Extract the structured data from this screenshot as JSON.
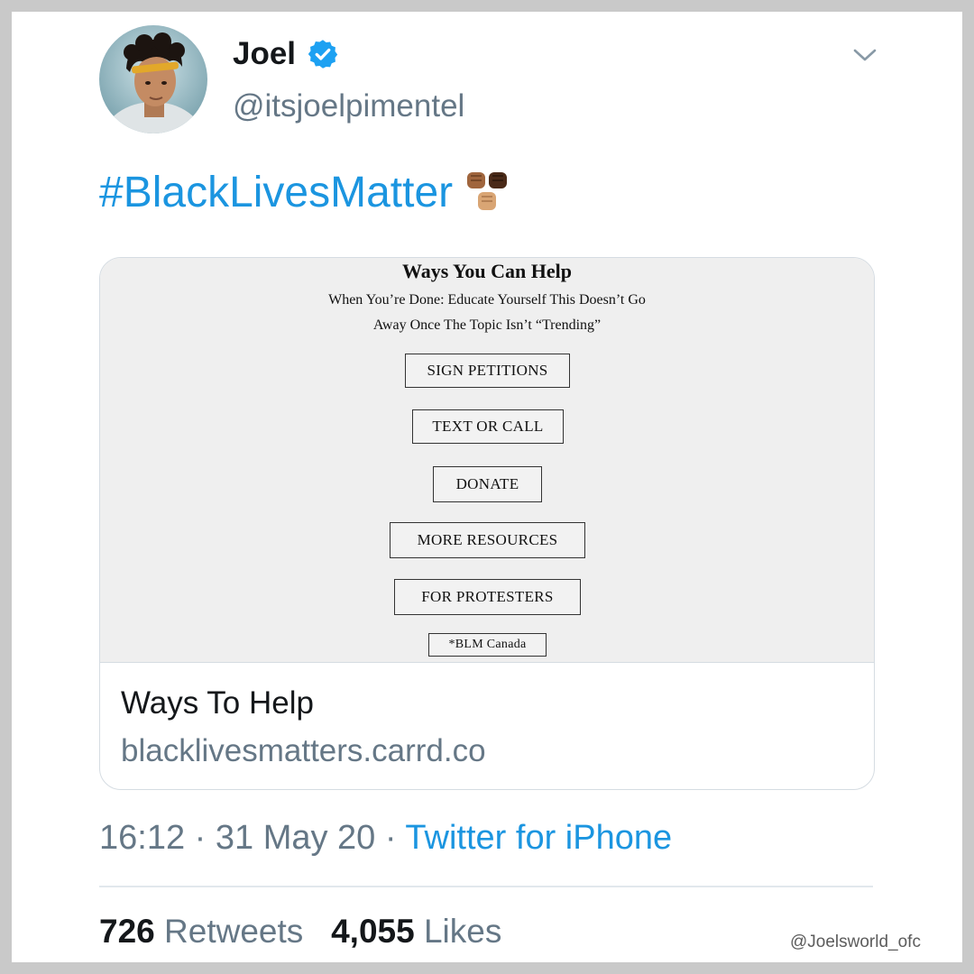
{
  "tweet": {
    "name": "Joel",
    "handle": "@itsjoelpimentel",
    "hashtag": "#BlackLivesMatter",
    "time": "16:12",
    "date": "31 May 20",
    "client": "Twitter for iPhone",
    "separator": " · "
  },
  "card": {
    "image": {
      "title": "Ways You Can Help",
      "subtitle_line1": "When You’re Done: Educate Yourself This Doesn’t Go",
      "subtitle_line2": "Away Once The Topic Isn’t “Trending”",
      "buttons": [
        "SIGN PETITIONS",
        "TEXT OR CALL",
        "DONATE",
        "MORE RESOURCES",
        "FOR PROTESTERS",
        "*BLM Canada"
      ]
    },
    "title": "Ways To Help",
    "domain": "blacklivesmatters.carrd.co"
  },
  "stats": {
    "retweets_count": "726",
    "retweets_label": "Retweets",
    "likes_count": "4,055",
    "likes_label": "Likes"
  },
  "watermark": "@Joelsworld_ofc",
  "icons": [
    "verified-badge-icon",
    "chevron-down-icon",
    "raised-fists-emoji-icon"
  ],
  "colors": {
    "link_blue": "#1b95e0",
    "secondary_gray": "#657786",
    "primary_text": "#14171a",
    "card_image_bg": "#efefef"
  }
}
